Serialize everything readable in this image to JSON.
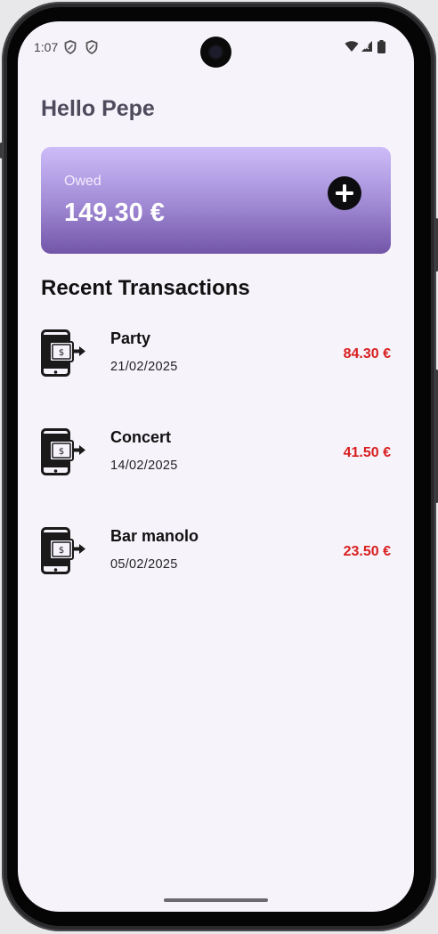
{
  "status_bar": {
    "time": "1:07",
    "icons": [
      "shield-icon",
      "shield-icon",
      "wifi-icon",
      "signal-icon",
      "battery-icon"
    ]
  },
  "greeting": "Hello Pepe",
  "owed_card": {
    "label": "Owed",
    "amount": "149.30 €",
    "add_icon": "plus-circle-icon",
    "gradient_top": "#cdbcf8",
    "gradient_bottom": "#7355a8"
  },
  "transactions": {
    "title": "Recent Transactions",
    "icon": "phone-payment-icon",
    "amount_color": "#d81f1f",
    "items": [
      {
        "name": "Party",
        "date": "21/02/2025",
        "amount": "84.30 €"
      },
      {
        "name": "Concert",
        "date": "14/02/2025",
        "amount": "41.50 €"
      },
      {
        "name": "Bar manolo",
        "date": "05/02/2025",
        "amount": "23.50 €"
      }
    ]
  }
}
